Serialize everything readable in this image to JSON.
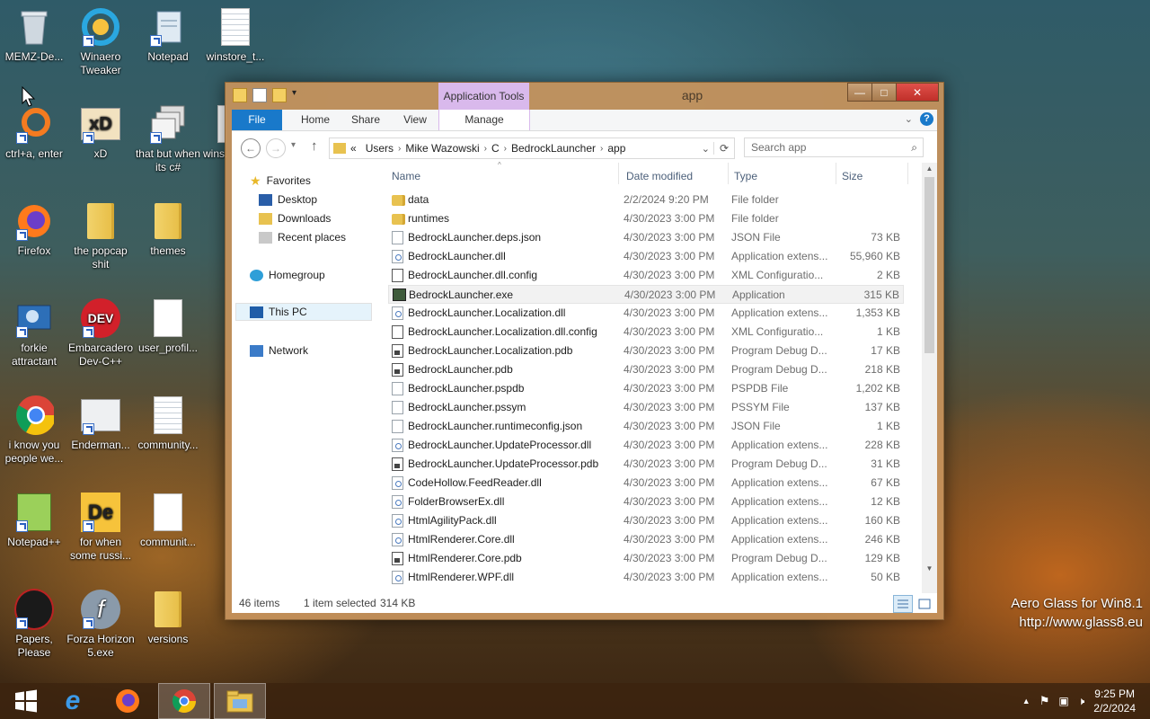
{
  "desktop": {
    "icons": [
      {
        "label": "MEMZ-De...",
        "icon": "recycle-bin-icon"
      },
      {
        "label": "Winaero Tweaker",
        "icon": "winaero-icon"
      },
      {
        "label": "Notepad",
        "icon": "notepad-icon"
      },
      {
        "label": "winstore_t...",
        "icon": "document-icon"
      },
      {
        "label": "ctrl+a, enter",
        "icon": "orange-ring-icon"
      },
      {
        "label": "xD",
        "icon": "xd-icon"
      },
      {
        "label": "that but when its c#",
        "icon": "windows-stack-icon"
      },
      {
        "label": "wins...",
        "icon": "document-icon"
      },
      {
        "label": "Firefox",
        "icon": "firefox-icon"
      },
      {
        "label": "the popcap shit",
        "icon": "folder-icon"
      },
      {
        "label": "themes",
        "icon": "folder-icon"
      },
      {
        "label": "forkie attractant",
        "icon": "settings-monitor-icon"
      },
      {
        "label": "Embarcadero Dev-C++",
        "icon": "devcpp-icon"
      },
      {
        "label": "user_profil...",
        "icon": "document-icon"
      },
      {
        "label": "i know you people we...",
        "icon": "chrome-icon"
      },
      {
        "label": "Enderman...",
        "icon": "image-icon"
      },
      {
        "label": "community...",
        "icon": "document-icon"
      },
      {
        "label": "Notepad++",
        "icon": "notepadpp-icon"
      },
      {
        "label": "for when some russi...",
        "icon": "de-icon"
      },
      {
        "label": "communit...",
        "icon": "document-icon"
      },
      {
        "label": "Papers, Please",
        "icon": "papers-please-icon"
      },
      {
        "label": "Forza Horizon 5.exe",
        "icon": "flash-icon"
      },
      {
        "label": "versions",
        "icon": "folder-icon"
      }
    ]
  },
  "window": {
    "title": "app",
    "context_tab": "Application Tools",
    "buttons": {
      "minimize": "—",
      "maximize": "□",
      "close": "✕"
    },
    "ribbon_tabs": [
      "File",
      "Home",
      "Share",
      "View",
      "Manage"
    ],
    "help": "?",
    "address": {
      "overflow": "«",
      "crumbs": [
        "Users",
        "Mike Wazowski",
        "C",
        "BedrockLauncher",
        "app"
      ]
    },
    "search_placeholder": "Search app",
    "nav_pane": {
      "favorites": "Favorites",
      "desktop": "Desktop",
      "downloads": "Downloads",
      "recent": "Recent places",
      "homegroup": "Homegroup",
      "thispc": "This PC",
      "network": "Network"
    },
    "columns": {
      "name": "Name",
      "date": "Date modified",
      "type": "Type",
      "size": "Size"
    },
    "files": [
      {
        "name": "data",
        "date": "2/2/2024 9:20 PM",
        "type": "File folder",
        "size": "",
        "kind": "folder"
      },
      {
        "name": "runtimes",
        "date": "4/30/2023 3:00 PM",
        "type": "File folder",
        "size": "",
        "kind": "folder"
      },
      {
        "name": "BedrockLauncher.deps.json",
        "date": "4/30/2023 3:00 PM",
        "type": "JSON File",
        "size": "73 KB",
        "kind": "doc"
      },
      {
        "name": "BedrockLauncher.dll",
        "date": "4/30/2023 3:00 PM",
        "type": "Application extens...",
        "size": "55,960 KB",
        "kind": "dll"
      },
      {
        "name": "BedrockLauncher.dll.config",
        "date": "4/30/2023 3:00 PM",
        "type": "XML Configuratio...",
        "size": "2 KB",
        "kind": "cfg"
      },
      {
        "name": "BedrockLauncher.exe",
        "date": "4/30/2023 3:00 PM",
        "type": "Application",
        "size": "315 KB",
        "kind": "exe",
        "selected": true
      },
      {
        "name": "BedrockLauncher.Localization.dll",
        "date": "4/30/2023 3:00 PM",
        "type": "Application extens...",
        "size": "1,353 KB",
        "kind": "dll"
      },
      {
        "name": "BedrockLauncher.Localization.dll.config",
        "date": "4/30/2023 3:00 PM",
        "type": "XML Configuratio...",
        "size": "1 KB",
        "kind": "cfg"
      },
      {
        "name": "BedrockLauncher.Localization.pdb",
        "date": "4/30/2023 3:00 PM",
        "type": "Program Debug D...",
        "size": "17 KB",
        "kind": "pdb"
      },
      {
        "name": "BedrockLauncher.pdb",
        "date": "4/30/2023 3:00 PM",
        "type": "Program Debug D...",
        "size": "218 KB",
        "kind": "pdb"
      },
      {
        "name": "BedrockLauncher.pspdb",
        "date": "4/30/2023 3:00 PM",
        "type": "PSPDB File",
        "size": "1,202 KB",
        "kind": "doc"
      },
      {
        "name": "BedrockLauncher.pssym",
        "date": "4/30/2023 3:00 PM",
        "type": "PSSYM File",
        "size": "137 KB",
        "kind": "doc"
      },
      {
        "name": "BedrockLauncher.runtimeconfig.json",
        "date": "4/30/2023 3:00 PM",
        "type": "JSON File",
        "size": "1 KB",
        "kind": "doc"
      },
      {
        "name": "BedrockLauncher.UpdateProcessor.dll",
        "date": "4/30/2023 3:00 PM",
        "type": "Application extens...",
        "size": "228 KB",
        "kind": "dll"
      },
      {
        "name": "BedrockLauncher.UpdateProcessor.pdb",
        "date": "4/30/2023 3:00 PM",
        "type": "Program Debug D...",
        "size": "31 KB",
        "kind": "pdb"
      },
      {
        "name": "CodeHollow.FeedReader.dll",
        "date": "4/30/2023 3:00 PM",
        "type": "Application extens...",
        "size": "67 KB",
        "kind": "dll"
      },
      {
        "name": "FolderBrowserEx.dll",
        "date": "4/30/2023 3:00 PM",
        "type": "Application extens...",
        "size": "12 KB",
        "kind": "dll"
      },
      {
        "name": "HtmlAgilityPack.dll",
        "date": "4/30/2023 3:00 PM",
        "type": "Application extens...",
        "size": "160 KB",
        "kind": "dll"
      },
      {
        "name": "HtmlRenderer.Core.dll",
        "date": "4/30/2023 3:00 PM",
        "type": "Application extens...",
        "size": "246 KB",
        "kind": "dll"
      },
      {
        "name": "HtmlRenderer.Core.pdb",
        "date": "4/30/2023 3:00 PM",
        "type": "Program Debug D...",
        "size": "129 KB",
        "kind": "pdb"
      },
      {
        "name": "HtmlRenderer.WPF.dll",
        "date": "4/30/2023 3:00 PM",
        "type": "Application extens...",
        "size": "50 KB",
        "kind": "dll"
      }
    ],
    "status": {
      "items": "46 items",
      "selected": "1 item selected",
      "size": "314 KB"
    }
  },
  "watermark": {
    "line1": "Aero Glass for Win8.1",
    "line2": "http://www.glass8.eu"
  },
  "taskbar": {
    "apps": [
      "start-icon",
      "internet-explorer-icon",
      "firefox-icon",
      "chrome-icon",
      "file-explorer-icon"
    ],
    "clock_time": "9:25 PM",
    "clock_date": "2/2/2024"
  },
  "colors": {
    "accent": "#1979ca",
    "context_tab": "#d9b9ec",
    "window_frame": "#c7935c"
  }
}
